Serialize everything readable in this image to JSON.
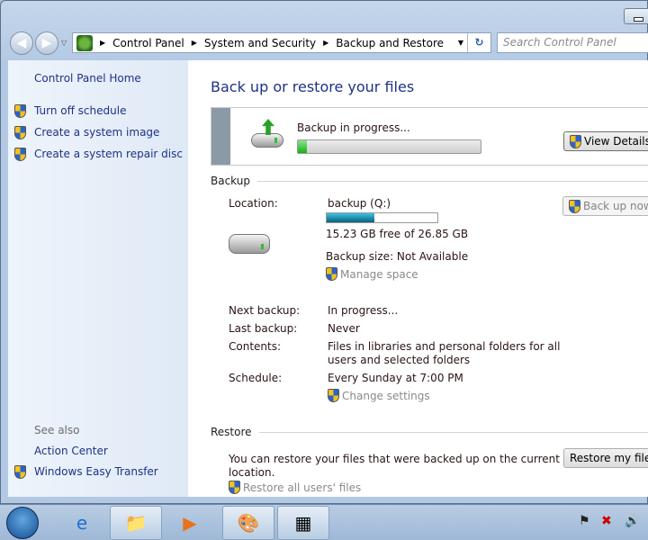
{
  "window": {
    "address": {
      "crumbs": [
        "Control Panel",
        "System and Security",
        "Backup and Restore"
      ]
    },
    "search_placeholder": "Search Control Panel"
  },
  "sidebar": {
    "home": "Control Panel Home",
    "tasks": [
      "Turn off schedule",
      "Create a system image",
      "Create a system repair disc"
    ],
    "see_also": "See also",
    "see_also_links": [
      "Action Center",
      "Windows Easy Transfer"
    ]
  },
  "main": {
    "title": "Back up or restore your files",
    "progress": {
      "status": "Backup in progress...",
      "percent": 2,
      "view_details": "View Details"
    },
    "backup": {
      "heading": "Backup",
      "location_label": "Location:",
      "location": "backup (Q:)",
      "disk_used_fraction": 0.43,
      "free": "15.23 GB free of 26.85 GB",
      "size": "Backup size: Not Available",
      "manage": "Manage space",
      "back_up_now": "Back up now",
      "next_label": "Next backup:",
      "next": "In progress...",
      "last_label": "Last backup:",
      "last": "Never",
      "contents_label": "Contents:",
      "contents_1": "Files in libraries and personal folders for all",
      "contents_2": "users and selected folders",
      "schedule_label": "Schedule:",
      "schedule": "Every Sunday at 7:00 PM",
      "change": "Change settings"
    },
    "restore": {
      "heading": "Restore",
      "text_1": "You can restore your files that were backed up on the current",
      "text_2": "location.",
      "restore_mine": "Restore my files",
      "restore_all": "Restore all users' files"
    }
  },
  "colors": {
    "link": "#1e3287",
    "progress": "#13b313"
  }
}
